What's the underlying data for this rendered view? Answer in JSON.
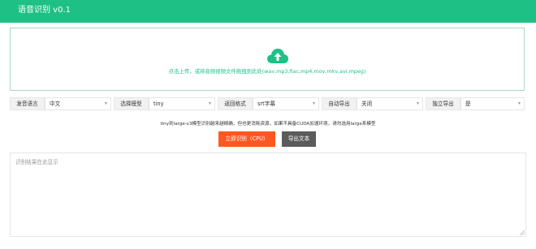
{
  "header": {
    "title": "语音识别 v0.1"
  },
  "upload": {
    "icon": "cloud-upload-icon",
    "hint": "点击上传，或将音频视频文件拖拽到此处(wav,mp3,flac,mp4,mov,mkv,avi,mpeg)"
  },
  "settings": [
    {
      "label": "发音语言",
      "value": "中文"
    },
    {
      "label": "选择模型",
      "value": "tiny"
    },
    {
      "label": "返回格式",
      "value": "srt字幕"
    },
    {
      "label": "自动导出",
      "value": "关闭"
    },
    {
      "label": "独立导出",
      "value": "是"
    }
  ],
  "note": "tiny到large-v3模型识别越来越精确，但也更消耗资源，如果不具备CUDA加速环境，请勿选用large系模型",
  "actions": {
    "start_label": "立即识别（CPU）",
    "export_label": "导出文本"
  },
  "result": {
    "placeholder": "识别结果在此显示"
  },
  "colors": {
    "header": "#1ec085",
    "accent": "#1ec085",
    "start_button": "#ff5722",
    "export_button": "#5b5b5b"
  }
}
